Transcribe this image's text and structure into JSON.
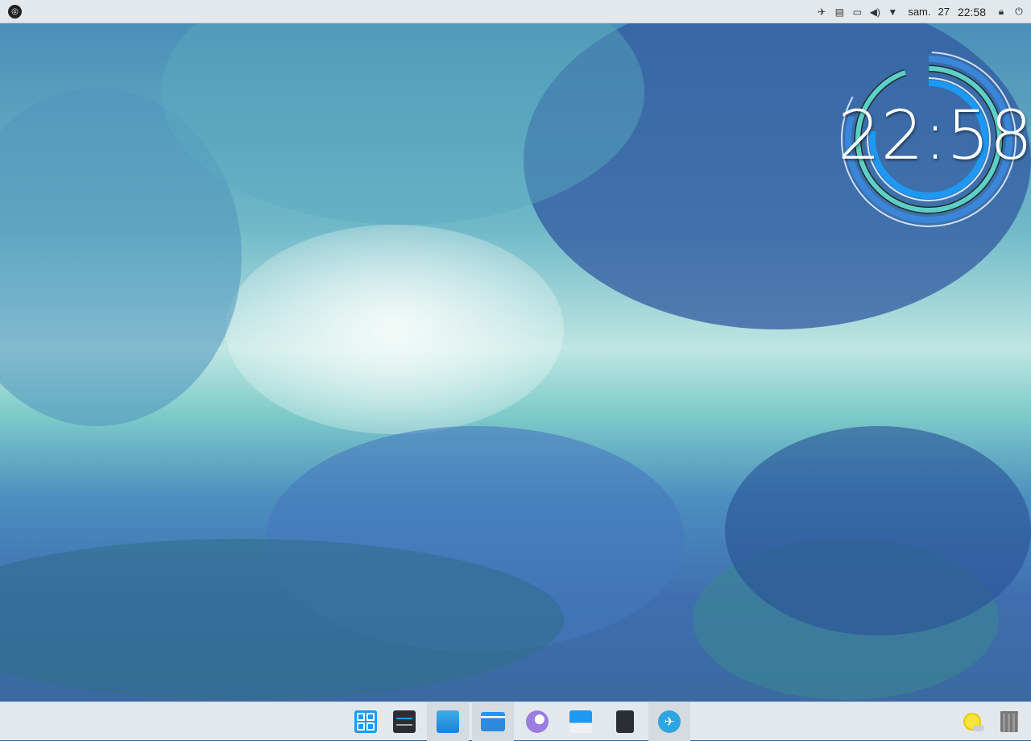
{
  "top_panel": {
    "launcher_icon": "opensuse-gecko-icon",
    "tray_icons": [
      "telegram-icon",
      "clipboard-icon",
      "network-icon",
      "volume-icon",
      "expand-arrow-icon"
    ],
    "date": "sam.",
    "day": "27",
    "time": "22:58",
    "lock_icon": "lock-icon",
    "power_icon": "power-icon"
  },
  "desktop": {
    "clock_widget_time": "22:58"
  },
  "taskbar": {
    "apps": [
      {
        "name": "application-launcher",
        "icon": "grid-icon"
      },
      {
        "name": "system-settings",
        "icon": "sliders-icon"
      },
      {
        "name": "discover",
        "icon": "store-bag-icon"
      },
      {
        "name": "file-manager",
        "icon": "folder-icon"
      },
      {
        "name": "kdenlive-or-browser",
        "icon": "bird-icon"
      },
      {
        "name": "mail-client",
        "icon": "mail-icon"
      },
      {
        "name": "text-editor",
        "icon": "document-icon"
      },
      {
        "name": "telegram",
        "icon": "telegram-icon"
      }
    ],
    "weather_icon": "weather-sun-cloud-icon",
    "trash_icon": "trash-icon"
  },
  "colors": {
    "panel": "#e3e8ec",
    "accent": "#1d99f3"
  }
}
